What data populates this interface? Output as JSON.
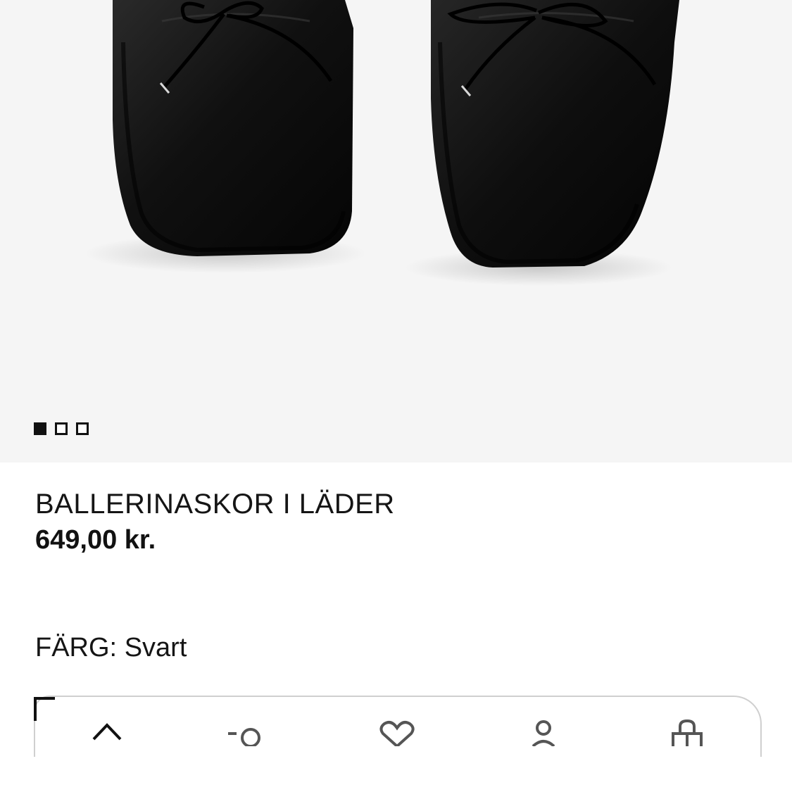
{
  "product": {
    "title": "BALLERINASKOR I LÄDER",
    "price": "649,00 kr.",
    "color_label": "FÄRG:",
    "color_value": "Svart"
  },
  "gallery": {
    "image_count": 3,
    "active_index": 0
  },
  "nav": {
    "tabs": [
      {
        "icon": "home-icon"
      },
      {
        "icon": "search-icon"
      },
      {
        "icon": "heart-icon"
      },
      {
        "icon": "account-icon"
      },
      {
        "icon": "shopping-bag-icon"
      }
    ]
  },
  "colors": {
    "background": "#f5f5f5",
    "shoe": "#111111",
    "text": "#111111"
  }
}
